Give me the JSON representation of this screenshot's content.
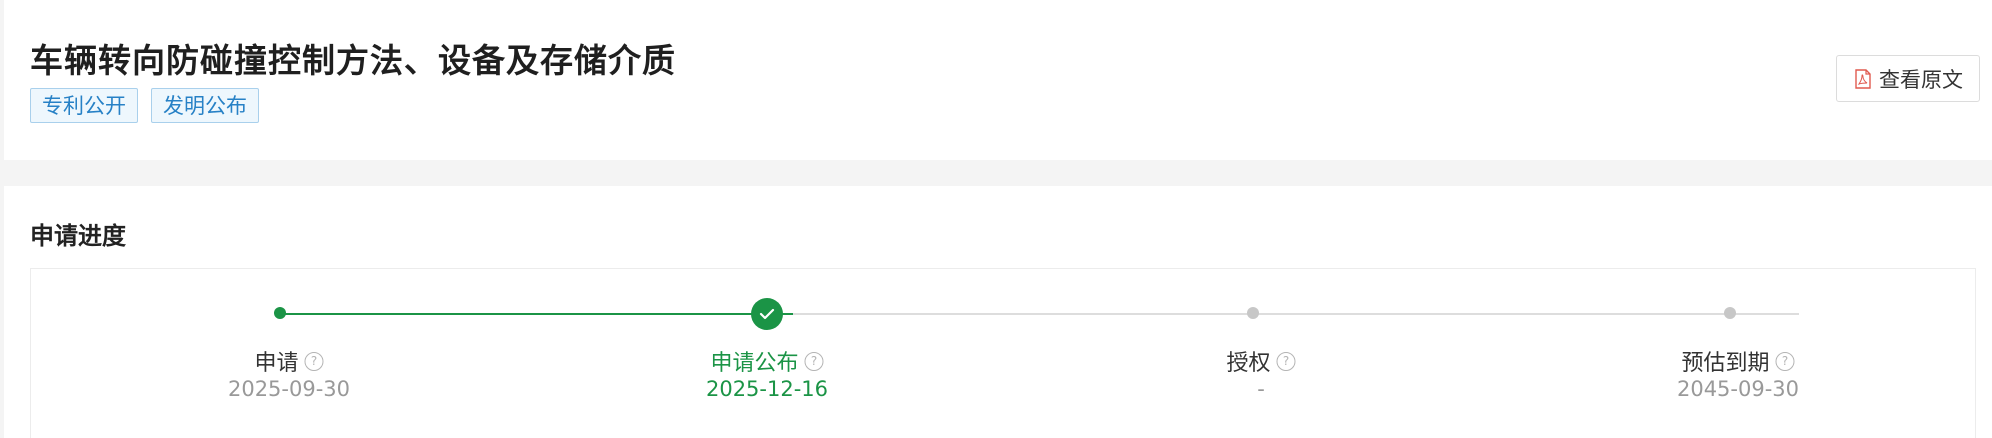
{
  "header": {
    "title": "车辆转向防碰撞控制方法、设备及存储介质",
    "tags": [
      "专利公开",
      "发明公布"
    ],
    "view_original_label": "查看原文",
    "view_original_icon": "pdf-icon"
  },
  "progress": {
    "section_title": "申请进度",
    "accent_color": "#1b9446",
    "steps": [
      {
        "label": "申请",
        "date": "2025-09-30",
        "state": "done",
        "help_icon": "question-icon"
      },
      {
        "label": "申请公布",
        "date": "2025-12-16",
        "state": "current",
        "help_icon": "question-icon"
      },
      {
        "label": "授权",
        "date": "-",
        "state": "pending",
        "help_icon": "question-icon"
      },
      {
        "label": "预估到期",
        "date": "2045-09-30",
        "state": "pending",
        "help_icon": "question-icon"
      }
    ]
  }
}
